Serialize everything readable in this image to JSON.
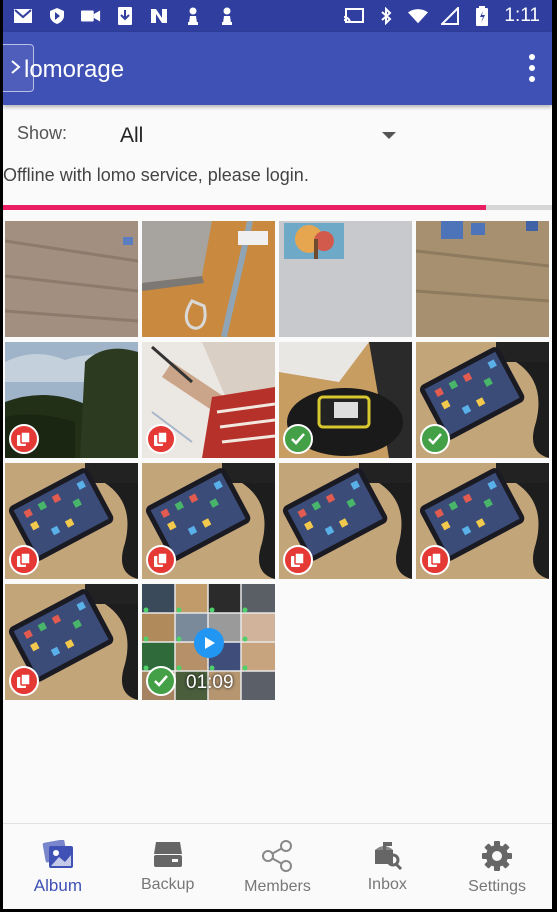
{
  "status_bar": {
    "time": "1:11",
    "left_icons": [
      "gmail-icon",
      "shield-icon",
      "video-camera-icon",
      "download-icon",
      "n-logo-icon",
      "chess-pawn-icon",
      "chess-pawn-icon"
    ],
    "right_icons": [
      "cast-icon",
      "bluetooth-icon",
      "wifi-icon",
      "signal-icon",
      "battery-icon"
    ]
  },
  "app_bar": {
    "title": "lomorage",
    "menu_icon": "overflow-menu-icon"
  },
  "filter": {
    "label": "Show:",
    "selected": "All"
  },
  "status_message": "Offline with lomo service, please login.",
  "sync_progress": 0.88,
  "gallery": {
    "items": [
      {
        "kind": "photo",
        "scene": "wood-floor",
        "status": "none"
      },
      {
        "kind": "photo",
        "scene": "cable-on-desk",
        "status": "none"
      },
      {
        "kind": "photo",
        "scene": "painting-on-wall",
        "status": "none"
      },
      {
        "kind": "photo",
        "scene": "wood-floor-blue",
        "status": "none"
      },
      {
        "kind": "photo",
        "scene": "sky-trees",
        "status": "not-backed-up"
      },
      {
        "kind": "photo",
        "scene": "drawing-hand",
        "status": "not-backed-up"
      },
      {
        "kind": "photo",
        "scene": "tape-measure",
        "status": "backed-up"
      },
      {
        "kind": "photo",
        "scene": "phone-on-desk",
        "status": "backed-up"
      },
      {
        "kind": "photo",
        "scene": "phone-on-desk",
        "status": "not-backed-up"
      },
      {
        "kind": "photo",
        "scene": "phone-on-desk",
        "status": "not-backed-up"
      },
      {
        "kind": "photo",
        "scene": "phone-on-desk",
        "status": "not-backed-up"
      },
      {
        "kind": "photo",
        "scene": "phone-on-desk",
        "status": "not-backed-up"
      },
      {
        "kind": "photo",
        "scene": "phone-on-desk",
        "status": "not-backed-up"
      },
      {
        "kind": "video",
        "scene": "video-mosaic",
        "status": "backed-up",
        "duration": "01:09"
      }
    ]
  },
  "bottom_nav": [
    {
      "label": "Album",
      "icon": "album-icon",
      "active": true
    },
    {
      "label": "Backup",
      "icon": "backup-drive-icon",
      "active": false
    },
    {
      "label": "Members",
      "icon": "share-icon",
      "active": false
    },
    {
      "label": "Inbox",
      "icon": "inbox-icon",
      "active": false
    },
    {
      "label": "Settings",
      "icon": "gear-icon",
      "active": false
    }
  ],
  "colors": {
    "primary": "#3f51b5",
    "primary_dark": "#303f9f",
    "progress": "#e91e63",
    "badge_pending": "#e53935",
    "badge_done": "#43a047"
  }
}
